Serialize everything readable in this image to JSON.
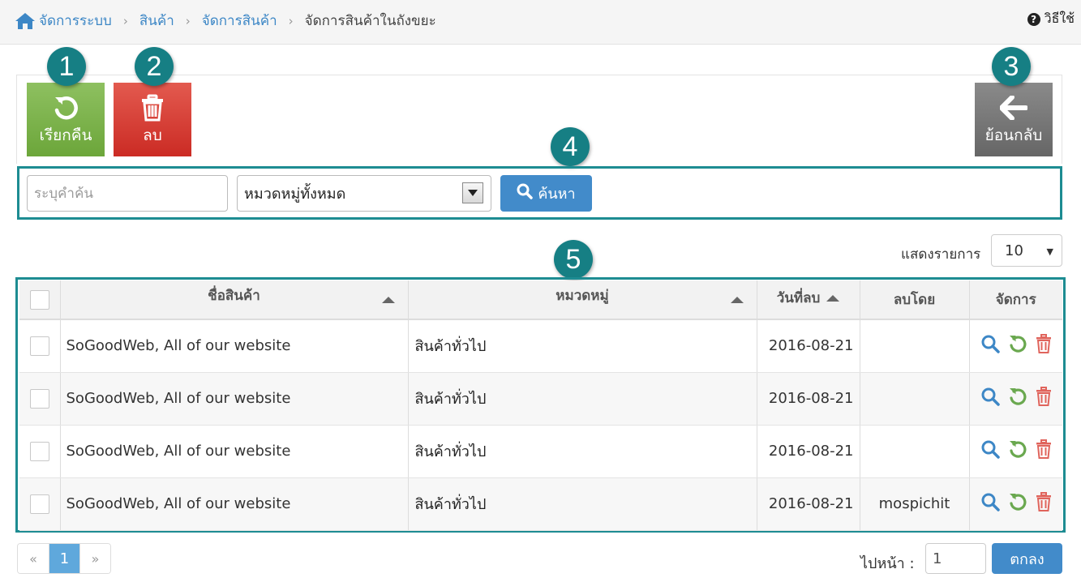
{
  "breadcrumb": {
    "home": "จัดการระบบ",
    "items": [
      "สินค้า",
      "จัดการสินค้า"
    ],
    "current": "จัดการสินค้าในถังขยะ"
  },
  "help": {
    "label": "วิธีใช้",
    "icon": "question-circle-icon"
  },
  "toolbar": {
    "restore": {
      "label": "เรียกคืน",
      "icon": "rotate-left-icon",
      "color": "#7cb342"
    },
    "delete": {
      "label": "ลบ",
      "icon": "trash-icon",
      "color": "#d9342b"
    },
    "back": {
      "label": "ย้อนกลับ",
      "icon": "arrow-left-icon",
      "color": "#777777"
    }
  },
  "badges": [
    "1",
    "2",
    "3",
    "4",
    "5"
  ],
  "search": {
    "placeholder": "ระบุคำค้น",
    "category_selected": "หมวดหมู่ทั้งหมด",
    "button_label": "ค้นหา"
  },
  "page_size": {
    "label": "แสดงรายการ",
    "value": "10"
  },
  "table": {
    "columns": {
      "name": "ชื่อสินค้า",
      "category": "หมวดหมู่",
      "deleted_date": "วันที่ลบ",
      "deleted_by": "ลบโดย",
      "actions": "จัดการ"
    },
    "rows": [
      {
        "name": "SoGoodWeb, All of our website",
        "category": "สินค้าทั่วไป",
        "date": "2016-08-21",
        "by": ""
      },
      {
        "name": "SoGoodWeb, All of our website",
        "category": "สินค้าทั่วไป",
        "date": "2016-08-21",
        "by": ""
      },
      {
        "name": "SoGoodWeb, All of our website",
        "category": "สินค้าทั่วไป",
        "date": "2016-08-21",
        "by": ""
      },
      {
        "name": "SoGoodWeb, All of our website",
        "category": "สินค้าทั่วไป",
        "date": "2016-08-21",
        "by": "mospichit"
      }
    ]
  },
  "pagination": {
    "prev": "«",
    "current": "1",
    "next": "»"
  },
  "goto": {
    "label": "ไปหน้า  :",
    "value": "1",
    "button": "ตกลง"
  },
  "colors": {
    "accent_blue": "#428bca",
    "frame_teal": "#1d8c92",
    "badge_teal": "#167f84"
  }
}
